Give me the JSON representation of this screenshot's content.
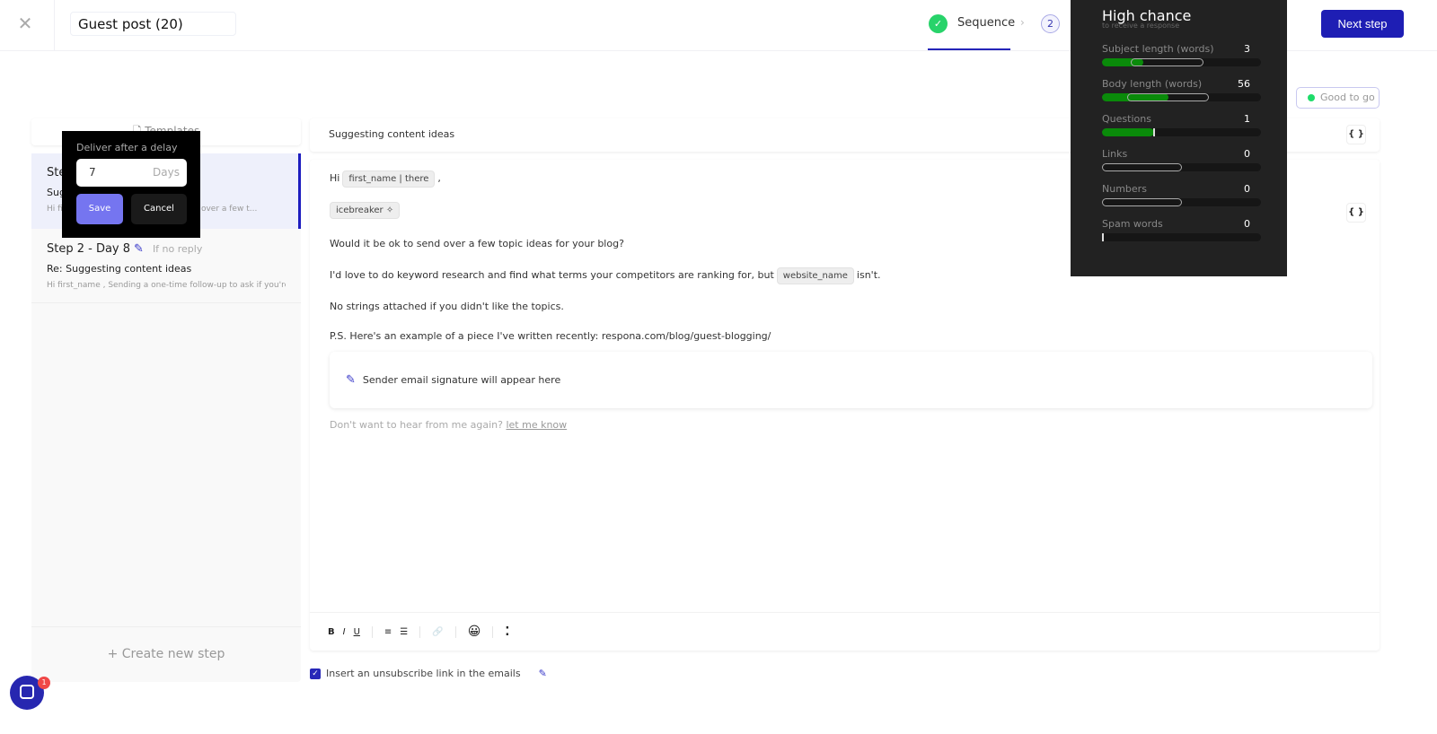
{
  "header": {
    "close_icon": "close-icon",
    "title": "Guest post (20)",
    "steps": [
      {
        "label": "Sequence",
        "state": "done"
      },
      {
        "label": "2",
        "state": "pending"
      }
    ],
    "next_label": "Next step"
  },
  "status": {
    "label": "Good to go",
    "color": "#1edc6a"
  },
  "sidebar": {
    "templates_label": "Templates",
    "steps": [
      {
        "title": "Step 1",
        "subject": "Suggesting content ideas",
        "preview": "Hi first_name , Would it be ok to send over a few t..."
      },
      {
        "title": "Step 2 - Day 8",
        "condition": "If no reply",
        "subject": "Re: Suggesting content ideas",
        "preview": "Hi first_name , Sending a one-time follow-up to ask if you're ..."
      }
    ],
    "create_label": "+  Create new step"
  },
  "delay_popup": {
    "label": "Deliver after a delay",
    "value": "7",
    "unit": "Days",
    "save": "Save",
    "cancel": "Cancel"
  },
  "editor": {
    "subject": "Suggesting content ideas",
    "greeting": "Hi",
    "var_first_name": "first_name | there",
    "comma": ",",
    "icebreaker": "icebreaker ✧",
    "line1": "Would it be ok to send over a few topic ideas for your blog?",
    "line2a": "I'd love to do keyword research and find what terms your competitors are ranking for, but",
    "var_website": "website_name",
    "line2b": "isn't.",
    "line3": "No strings attached if you didn't like the topics.",
    "line4": "P.S. Here's an example of a piece I've written recently: respona.com/blog/guest-blogging/",
    "signature": "Sender email signature will appear here",
    "unsub_text": "Don't want to hear from me again?",
    "unsub_link": "let me know",
    "brace": "{ }",
    "toolbar": {
      "bold": "B",
      "italic": "I",
      "underline": "U",
      "ordered": "≡",
      "bullet": "☰",
      "link": "🔗",
      "emoji": "😀",
      "more": "⁚"
    }
  },
  "unsubscribe_option": {
    "label": "Insert an unsubscribe link in the emails",
    "checked": true
  },
  "score_panel": {
    "title": "High chance",
    "subtitle": "to receive a response",
    "metrics": [
      {
        "name": "Subject length (words)",
        "value": "3",
        "fill": 0.26,
        "range": [
          0.18,
          0.64
        ]
      },
      {
        "name": "Body length (words)",
        "value": "56",
        "fill": 0.42,
        "range": [
          0.16,
          0.67
        ]
      },
      {
        "name": "Questions",
        "value": "1",
        "fill": 0.33,
        "range": null
      },
      {
        "name": "Links",
        "value": "0",
        "fill": 0,
        "range": [
          0,
          0.5
        ]
      },
      {
        "name": "Numbers",
        "value": "0",
        "fill": 0,
        "range": [
          0,
          0.5
        ]
      },
      {
        "name": "Spam words",
        "value": "0",
        "fill": 0,
        "range": null
      }
    ]
  },
  "chat": {
    "badge": "1"
  }
}
